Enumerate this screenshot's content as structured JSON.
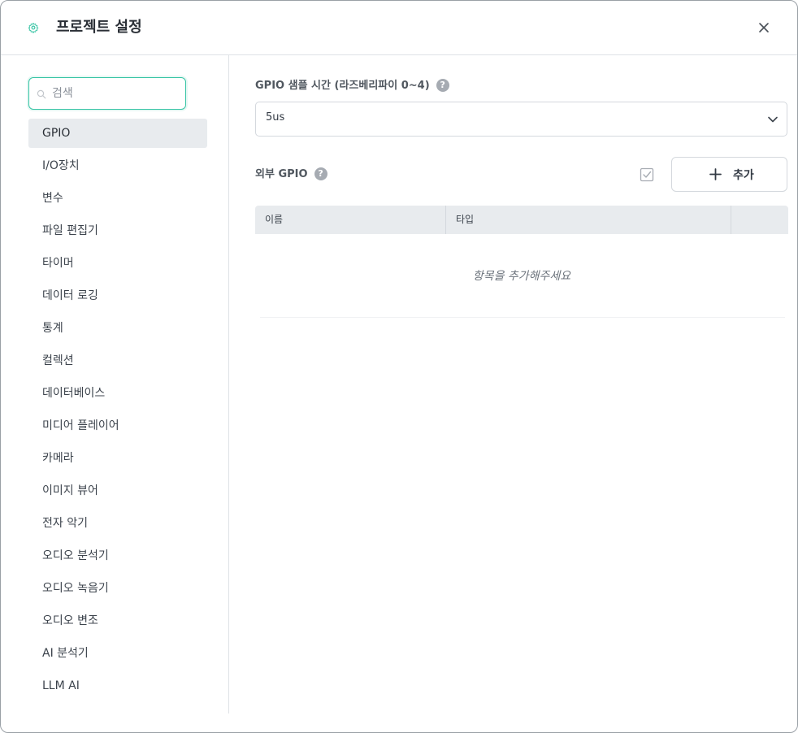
{
  "header": {
    "title": "프로젝트 설정",
    "settings_icon": "gear-icon",
    "close_icon": "close-icon"
  },
  "sidebar": {
    "search_placeholder": "검색",
    "search_value": "",
    "items": [
      {
        "label": "GPIO",
        "active": true
      },
      {
        "label": "I/O장치"
      },
      {
        "label": "변수"
      },
      {
        "label": "파일 편집기"
      },
      {
        "label": "타이머"
      },
      {
        "label": "데이터 로깅"
      },
      {
        "label": "통계"
      },
      {
        "label": "컬렉션"
      },
      {
        "label": "데이터베이스"
      },
      {
        "label": "미디어 플레이어"
      },
      {
        "label": "카메라"
      },
      {
        "label": "이미지 뷰어"
      },
      {
        "label": "전자 악기"
      },
      {
        "label": "오디오 분석기"
      },
      {
        "label": "오디오 녹음기"
      },
      {
        "label": "오디오 변조"
      },
      {
        "label": "AI 분석기"
      },
      {
        "label": "LLM AI"
      }
    ]
  },
  "main": {
    "sample_time": {
      "label": "GPIO 샘플 시간 (라즈베리파이 0~4)",
      "help": "?",
      "selected": "5us"
    },
    "external_gpio": {
      "label": "외부 GPIO",
      "help": "?",
      "add_label": "추가",
      "columns": [
        "이름",
        "타입",
        ""
      ],
      "empty_message": "항목을 추가해주세요"
    }
  },
  "colors": {
    "accent": "#36c4a4",
    "active_bg": "#e8ebee",
    "border": "#d4d8dd"
  }
}
